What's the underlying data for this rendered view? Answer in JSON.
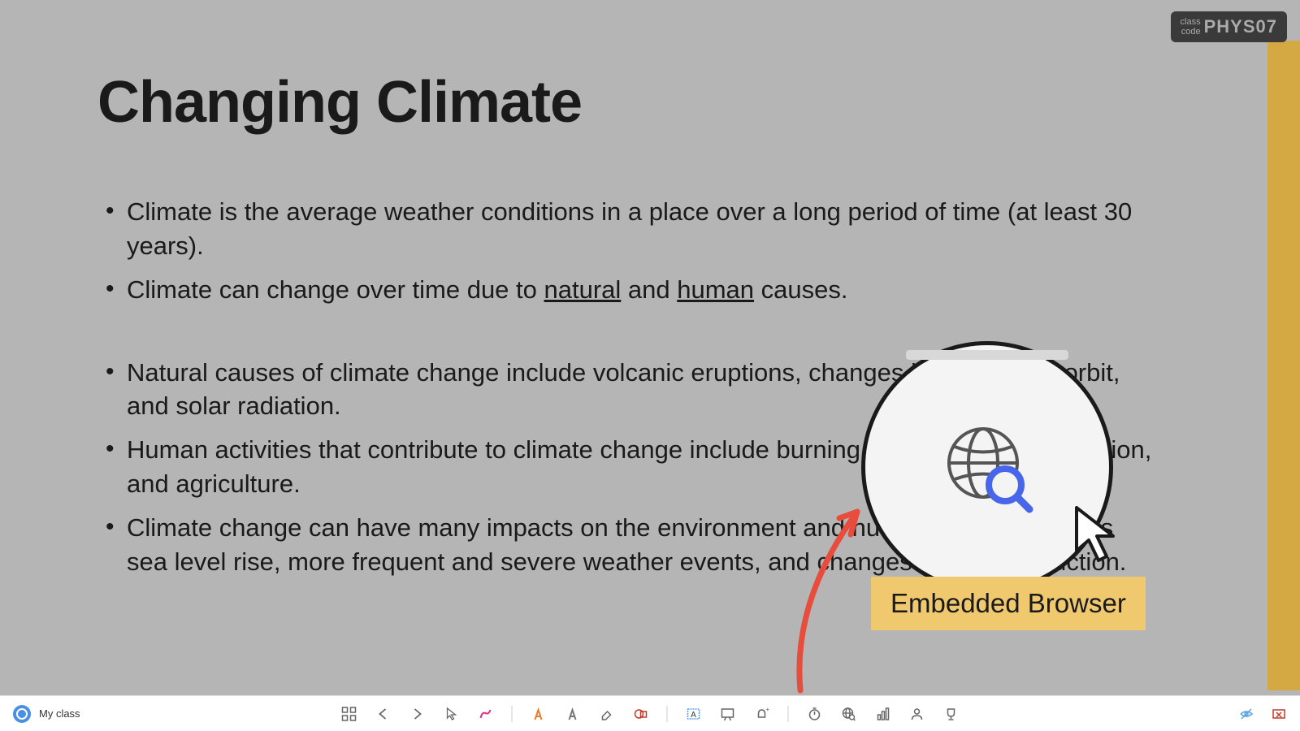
{
  "class_code": {
    "label": "class code",
    "value": "PHYS07"
  },
  "slide": {
    "title": "Changing Climate",
    "bullets": [
      {
        "text_pre": "Climate is the average weather conditions in a place over a long period of time (at least 30 years).",
        "gap": false
      },
      {
        "text_pre": "Climate can change over time due to ",
        "underline1": "natural",
        "text_mid": " and ",
        "underline2": "human",
        "text_post": " causes.",
        "gap": false,
        "has_underlines": true
      },
      {
        "text_pre": "Natural causes of climate change include volcanic eruptions, changes in the Earth's orbit, and solar radiation.",
        "gap": true
      },
      {
        "text_pre": "Human activities that contribute to climate change include burning fossil fuels, deforestation, and agriculture.",
        "gap": false
      },
      {
        "text_pre": "Climate change can have many impacts on the environment and human society, such as sea level rise, more frequent and severe weather events, and changes in food production.",
        "gap": false
      }
    ]
  },
  "callout": {
    "label": "Embedded Browser"
  },
  "toolbar": {
    "my_class": "My class"
  }
}
